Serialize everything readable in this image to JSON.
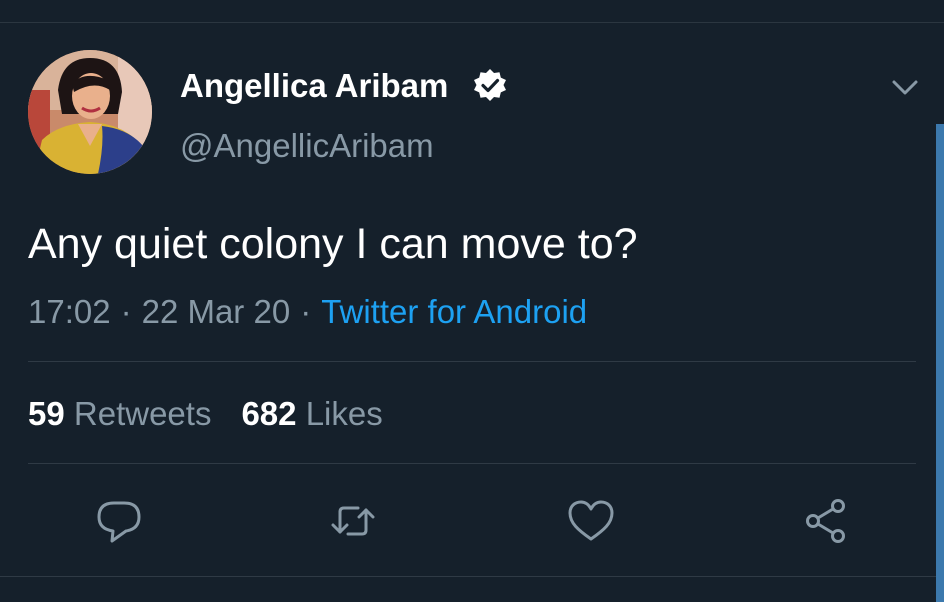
{
  "tweet": {
    "author_name": "Angellica Aribam",
    "author_handle": "@AngellicAribam",
    "verified": true,
    "text": "Any quiet colony I can move to?",
    "time": "17:02",
    "separator": "·",
    "date": "22 Mar 20",
    "source": "Twitter for Android"
  },
  "stats": {
    "retweets_count": "59",
    "retweets_label": "Retweets",
    "likes_count": "682",
    "likes_label": "Likes"
  },
  "icons": {
    "verified": "verified-badge-icon",
    "menu": "chevron-down-icon",
    "reply": "reply-icon",
    "retweet": "retweet-icon",
    "like": "heart-icon",
    "share": "share-icon"
  },
  "colors": {
    "background": "#15202b",
    "text_primary": "#ffffff",
    "text_secondary": "#8899a6",
    "accent": "#1da1f2",
    "divider": "#2f3a45"
  }
}
